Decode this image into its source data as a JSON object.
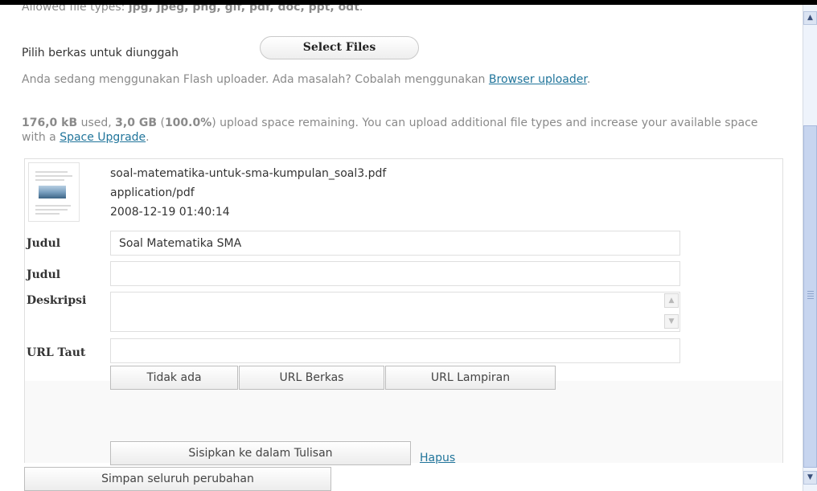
{
  "header": {
    "allowed_prefix": "Allowed file types: ",
    "allowed_types": "jpg, jpeg, png, gif, pdf, doc, ppt, odt",
    "allowed_suffix": "."
  },
  "upload": {
    "choose_label": "Pilih berkas untuk diunggah",
    "select_button": "Select Files",
    "flash_text": "Anda sedang menggunakan Flash uploader. Ada masalah? Cobalah menggunakan ",
    "browser_link": "Browser uploader",
    "flash_end": "."
  },
  "space": {
    "used": "176,0 kB",
    "used_text": " used, ",
    "remaining": "3,0 GB",
    "paren_open": " (",
    "percent": "100.0%",
    "remaining_text": ") upload space remaining. You can upload additional file types and increase your available space with a ",
    "upgrade_link": "Space Upgrade",
    "end": "."
  },
  "attachment": {
    "thumbnail_icon": "document-thumbnail-icon",
    "filename": "soal-matematika-untuk-sma-kumpulan_soal3.pdf",
    "mime": "application/pdf",
    "date": "2008-12-19 01:40:14",
    "fields": {
      "title_label": "Judul",
      "title_value": "Soal Matematika SMA",
      "caption_label": "Judul",
      "caption_value": "",
      "description_label": "Deskripsi",
      "description_value": "",
      "url_label": "URL Taut",
      "url_value": ""
    },
    "url_buttons": [
      "Tidak ada",
      "URL Berkas",
      "URL Lampiran"
    ],
    "insert_button": "Sisipkan ke dalam Tulisan",
    "delete_link": "Hapus"
  },
  "footer": {
    "save_button": "Simpan seluruh perubahan"
  },
  "scrollbar": {
    "up_icon": "scroll-up-arrow-icon",
    "down_icon": "scroll-down-arrow-icon"
  },
  "colors": {
    "link": "#21759b",
    "muted_text": "#8a8a8a",
    "panel_background": "#f9f9f9"
  }
}
